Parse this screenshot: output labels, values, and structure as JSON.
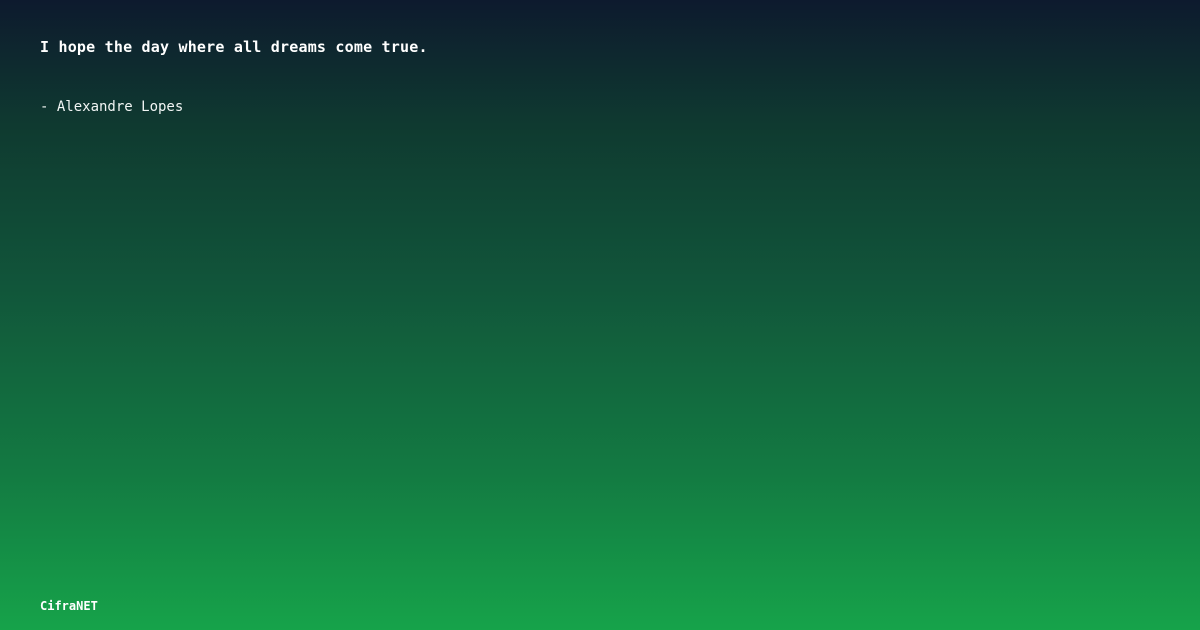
{
  "quote": {
    "text": "I hope the day where all dreams come true.",
    "author": "- Alexandre Lopes"
  },
  "brand": {
    "name": "CifraNET"
  },
  "colors": {
    "gradient_top": "#0d1a2e",
    "gradient_bottom": "#16a34a",
    "text": "#ffffff"
  }
}
